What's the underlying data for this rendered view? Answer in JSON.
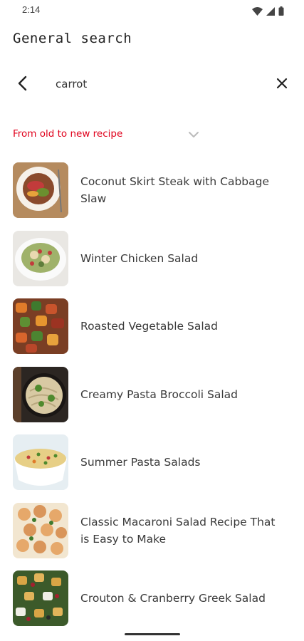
{
  "status_bar": {
    "time": "2:14",
    "icons": [
      "wifi-icon",
      "cellular-signal-icon",
      "battery-icon"
    ]
  },
  "page": {
    "title": "General search"
  },
  "search": {
    "query": "carrot",
    "back_icon": "back-arrow-icon",
    "clear_icon": "close-icon"
  },
  "sort": {
    "selected": "From old to new recipe",
    "icon": "chevron-down-icon"
  },
  "colors": {
    "accent": "#e0001b",
    "text": "#3a3a3a",
    "background": "#ffffff"
  },
  "results": [
    {
      "title": "Coconut Skirt Steak with Cabbage Slaw",
      "image": "skirt-steak-plate-image"
    },
    {
      "title": "Winter Chicken Salad",
      "image": "chicken-salad-plate-image"
    },
    {
      "title": "Roasted Vegetable Salad",
      "image": "roasted-vegetables-image"
    },
    {
      "title": "Creamy Pasta Broccoli Salad",
      "image": "pasta-broccoli-bowl-image"
    },
    {
      "title": "Summer Pasta Salads",
      "image": "pasta-salad-bowl-image"
    },
    {
      "title": "Classic Macaroni Salad Recipe That is Easy to Make",
      "image": "macaroni-salad-image"
    },
    {
      "title": "Crouton & Cranberry Greek Salad",
      "image": "crouton-greek-salad-image"
    }
  ]
}
